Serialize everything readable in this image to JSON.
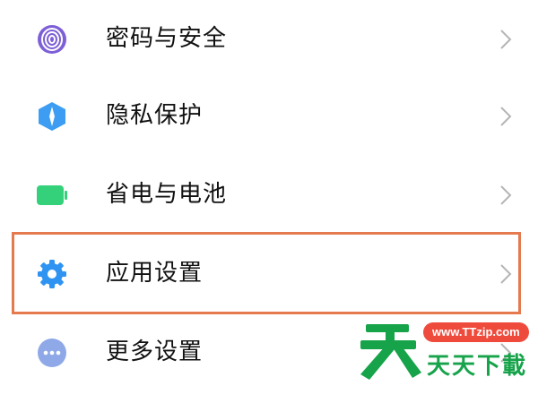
{
  "settings_list": {
    "items": [
      {
        "id": "security",
        "label": "密码与安全",
        "icon": "fingerprint-icon",
        "icon_color": "#7d5fd6"
      },
      {
        "id": "privacy",
        "label": "隐私保护",
        "icon": "shield-icon",
        "icon_color": "#3c9df2"
      },
      {
        "id": "battery",
        "label": "省电与电池",
        "icon": "battery-icon",
        "icon_color": "#34d17a"
      },
      {
        "id": "apps",
        "label": "应用设置",
        "icon": "gear-icon",
        "icon_color": "#2f93f2",
        "highlighted": true
      },
      {
        "id": "more",
        "label": "更多设置",
        "icon": "more-dots-icon",
        "icon_color": "#8fa9e8"
      }
    ],
    "chevron_icon": "chevron-right-icon",
    "highlight_color": "#e57a4f"
  },
  "watermark": {
    "url": "www.TTzip.com",
    "name": "天天下載",
    "color": "#16a34a",
    "badge_color": "#ef4b3c"
  }
}
